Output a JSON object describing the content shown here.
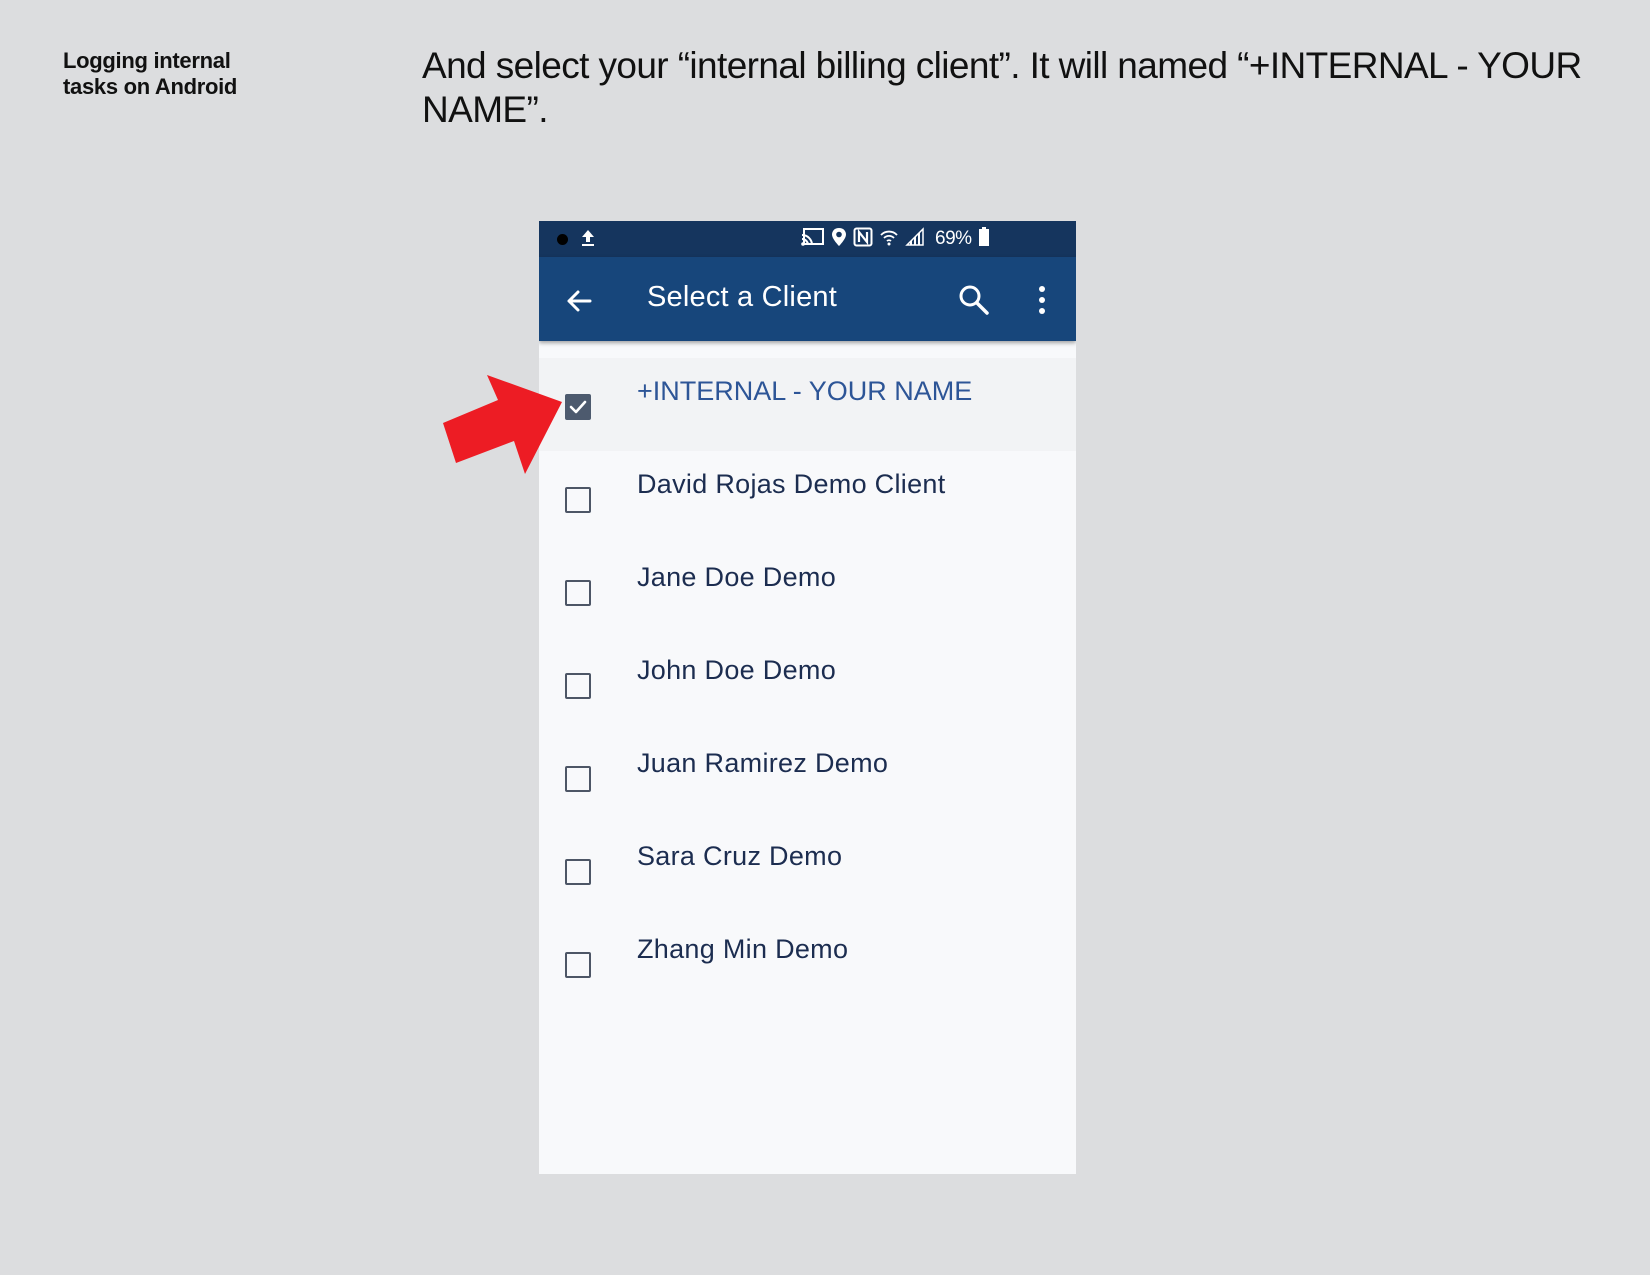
{
  "slide": {
    "caption": "Logging internal\ntasks on Android",
    "instruction": "And select your “internal billing client”. It will named “+INTERNAL - YOUR NAME”."
  },
  "status_bar": {
    "battery": "69%",
    "icons": [
      "record-dot-icon",
      "upload-icon",
      "cast-icon",
      "location-icon",
      "nfc-icon",
      "wifi-icon",
      "signal-icon",
      "battery-icon"
    ]
  },
  "app_bar": {
    "title": "Select a Client",
    "icons": [
      "back-arrow-icon",
      "search-icon",
      "more-vert-icon"
    ]
  },
  "clients": [
    {
      "name": "+INTERNAL -  YOUR NAME",
      "checked": true
    },
    {
      "name": "David Rojas Demo Client",
      "checked": false
    },
    {
      "name": "Jane Doe Demo",
      "checked": false
    },
    {
      "name": "John Doe Demo",
      "checked": false
    },
    {
      "name": "Juan Ramirez Demo",
      "checked": false
    },
    {
      "name": "Sara Cruz Demo",
      "checked": false
    },
    {
      "name": "Zhang Min Demo",
      "checked": false
    }
  ],
  "colors": {
    "status_bar": "#15355e",
    "app_bar": "#17467b",
    "selected_text": "#2d5597",
    "arrow": "#ed1c24"
  }
}
